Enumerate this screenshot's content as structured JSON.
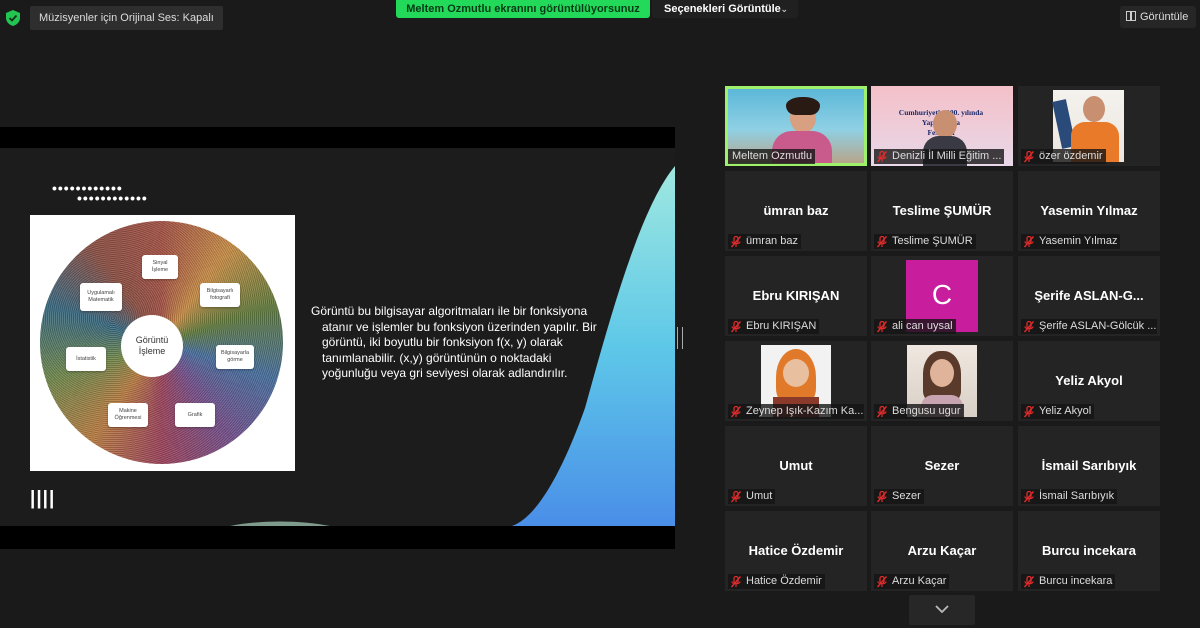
{
  "top_bar": {
    "original_sound_label": "Müzisyenler için Orijinal Ses: Kapalı",
    "sharing_banner": "Meltem Ozmutlu ekranını görüntülüyorsunuz",
    "view_options_label": "Seçenekleri Görüntüle",
    "view_button_label": "Görüntüle",
    "accent_color": "#23d959"
  },
  "slide": {
    "wheel": {
      "center": "Görüntü\nİşleme",
      "nodes": [
        "Sinyal\nİşleme",
        "Bilgisayarlı\nfotografi",
        "Bilgisayarla\ngörme",
        "Grafik",
        "Makine\nÖğrenmesi",
        "İstatistik",
        "Uygulamalı\nMatematik"
      ]
    },
    "body_text": "Görüntü bu bilgisayar algoritmaları ile bir fonksiyona atanır ve işlemler bu fonksiyon üzerinden yapılır. Bir görüntü, iki boyutlu bir fonksiyon f(x, y) olarak tanımlanabilir. (x,y) görüntünün o noktadaki yoğunluğu veya gri seviyesi olarak adlandırılır.",
    "decor_dots": "••••••••••••",
    "decor_bars": "||||"
  },
  "participants": [
    {
      "label": "Meltem Ozmutlu",
      "muted": false,
      "video": true,
      "active_speaker": true
    },
    {
      "label": "Denizli İl Milli Eğitim ...",
      "muted": true,
      "video": true
    },
    {
      "label": "özer özdemir",
      "muted": true,
      "video": true
    },
    {
      "name": "ümran baz",
      "label": "ümran baz",
      "muted": true
    },
    {
      "name": "Teslime ŞUMÜR",
      "label": "Teslime ŞUMÜR",
      "muted": true
    },
    {
      "name": "Yasemin Yılmaz",
      "label": "Yasemin Yılmaz",
      "muted": true
    },
    {
      "name": "Ebru KIRIŞAN",
      "label": "Ebru KIRIŞAN",
      "muted": true
    },
    {
      "avatar_letter": "C",
      "avatar_color": "#c81e9e",
      "label": "ali can uysal",
      "muted": true
    },
    {
      "name": "Şerife  ASLAN-G...",
      "label": "Şerife ASLAN-Gölcük ...",
      "muted": true
    },
    {
      "label": "Zeynep Işık-Kazım Ka...",
      "muted": true,
      "video": true
    },
    {
      "label": "Bengusu ugur",
      "muted": true,
      "video": true
    },
    {
      "name": "Yeliz Akyol",
      "label": "Yeliz Akyol",
      "muted": true
    },
    {
      "name": "Umut",
      "label": "Umut",
      "muted": true
    },
    {
      "name": "Sezer",
      "label": "Sezer",
      "muted": true
    },
    {
      "name": "İsmail Sarıbıyık",
      "label": "İsmail Sarıbıyık",
      "muted": true
    },
    {
      "name": "Hatice Özdemir",
      "label": "Hatice Özdemir",
      "muted": true
    },
    {
      "name": "Arzu Kaçar",
      "label": "Arzu Kaçar",
      "muted": true
    },
    {
      "name": "Burcu incekara",
      "label": "Burcu incekara",
      "muted": true
    }
  ],
  "thumbnails": {
    "festival_banner_lines": [
      "Cumhuriyetin 100. yılında",
      "Yapay Zeka",
      "Festivali"
    ]
  }
}
